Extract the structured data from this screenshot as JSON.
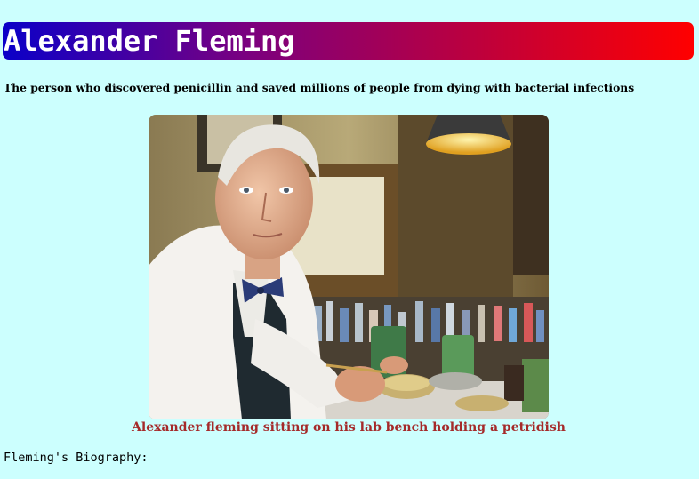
{
  "header": {
    "title": "Alexander Fleming",
    "gradient_colors": [
      "#0a00c8",
      "#7a0080",
      "#c0003a",
      "#ff0000"
    ]
  },
  "intro": {
    "tagline": "The person who discovered penicillin and saved millions of people from dying with bacterial infections"
  },
  "figure": {
    "caption": "Alexander fleming sitting on his lab bench holding a petridish",
    "caption_color": "#a52a2a"
  },
  "biography": {
    "heading": "Fleming's Biography:"
  },
  "page": {
    "background_color": "#ccfffe"
  }
}
